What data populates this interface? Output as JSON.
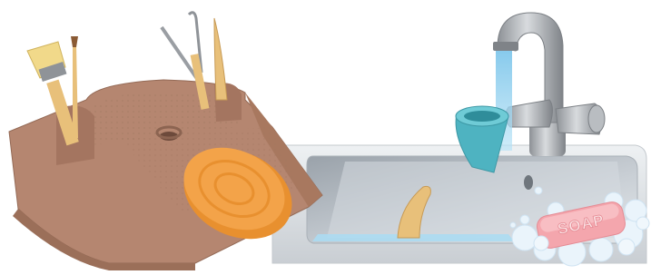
{
  "scene": {
    "soap_label": "SOAP",
    "colors": {
      "background": "#ffffff",
      "tray": "#b88a72",
      "tray_shadow": "#9b6f59",
      "sponge": "#f3a349",
      "sink_steel": "#d4d8dc",
      "basin": "#bfc5cb",
      "water": "#9fd4ee",
      "faucet": "#9a9ea3",
      "cup": "#5cc0cc",
      "soap": "#f4a6ad",
      "bubbles": "#e6f2fb",
      "brush_bristles": "#f1d98a",
      "wood_tool": "#e8c07a"
    }
  }
}
